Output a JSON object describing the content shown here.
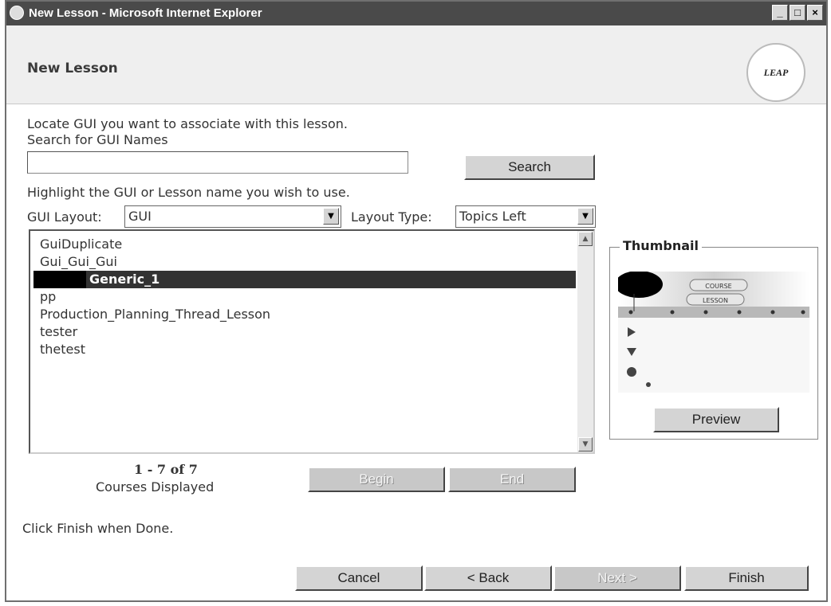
{
  "window": {
    "title": "New Lesson - Microsoft Internet Explorer",
    "minimize": "_",
    "maximize": "□",
    "close": "×"
  },
  "header": {
    "heading": "New Lesson",
    "logo_text": "LEAP"
  },
  "instructions": {
    "locate": "Locate GUI you want to associate with this lesson.",
    "search_label": "Search for GUI Names",
    "highlight": "Highlight the GUI or Lesson name you wish to use."
  },
  "search": {
    "value": "",
    "button_label": "Search"
  },
  "gui_layout": {
    "label": "GUI Layout:",
    "selected": "GUI"
  },
  "layout_type": {
    "label": "Layout Type:",
    "selected": "Topics Left"
  },
  "list": {
    "items": [
      {
        "label": "GuiDuplicate",
        "selected": false
      },
      {
        "label": "Gui_Gui_Gui",
        "selected": false
      },
      {
        "label": "Generic_1",
        "selected": true
      },
      {
        "label": "pp",
        "selected": false
      },
      {
        "label": "Production_Planning_Thread_Lesson",
        "selected": false
      },
      {
        "label": "tester",
        "selected": false
      },
      {
        "label": "thetest",
        "selected": false
      }
    ]
  },
  "pagination": {
    "range": "1 - 7 of 7",
    "caption": "Courses Displayed",
    "begin_label": "Begin",
    "end_label": "End"
  },
  "thumbnail": {
    "legend": "Thumbnail",
    "course_tab": "COURSE",
    "lesson_tab": "LESSON",
    "preview_label": "Preview"
  },
  "footer": {
    "instruction": "Click Finish when Done.",
    "cancel_label": "Cancel",
    "back_label": "< Back",
    "next_label": "Next >",
    "finish_label": "Finish"
  },
  "colors": {
    "selection": "#333333",
    "header_bg": "#efefef",
    "title_bar": "#4a4a4a"
  }
}
